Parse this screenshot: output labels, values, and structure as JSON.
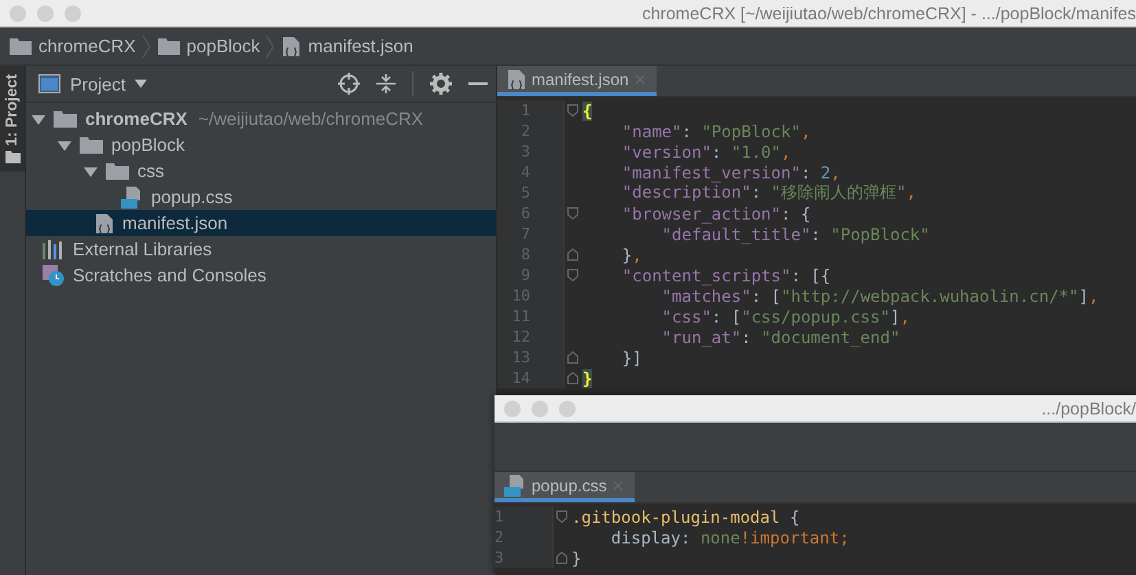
{
  "window": {
    "title": "chromeCRX [~/weijiutao/web/chromeCRX] - .../popBlock/manifes"
  },
  "breadcrumbs": [
    {
      "label": "chromeCRX",
      "kind": "folder"
    },
    {
      "label": "popBlock",
      "kind": "folder"
    },
    {
      "label": "manifest.json",
      "kind": "json"
    }
  ],
  "tool_stripe": {
    "label": "1: Project",
    "selected": true
  },
  "project_panel": {
    "title": "Project",
    "tree": [
      {
        "label": "chromeCRX",
        "hint": "~/weijiutao/web/chromeCRX",
        "kind": "folder",
        "bold": true,
        "expanded": true,
        "selected": false,
        "children": [
          {
            "label": "popBlock",
            "kind": "folder",
            "expanded": true,
            "selected": false,
            "children": [
              {
                "label": "css",
                "kind": "folder",
                "expanded": true,
                "selected": false,
                "children": [
                  {
                    "label": "popup.css",
                    "kind": "css",
                    "selected": false
                  }
                ]
              },
              {
                "label": "manifest.json",
                "kind": "json",
                "selected": true
              }
            ]
          }
        ]
      },
      {
        "label": "External Libraries",
        "kind": "libraries",
        "selected": false
      },
      {
        "label": "Scratches and Consoles",
        "kind": "scratches",
        "selected": false
      }
    ]
  },
  "editor": {
    "tab": {
      "label": "manifest.json",
      "kind": "json",
      "selected": true
    },
    "lines": [
      {
        "number": "1",
        "kind": "opener",
        "tokens": [
          {
            "text": "{",
            "kind": "match"
          }
        ]
      },
      {
        "number": "2",
        "tokens": [
          {
            "text": "    \"name\"",
            "kind": "key"
          },
          {
            "text": ": ",
            "kind": "plain"
          },
          {
            "text": "\"PopBlock\"",
            "kind": "str"
          },
          {
            "text": ",",
            "kind": "punct"
          }
        ]
      },
      {
        "number": "3",
        "tokens": [
          {
            "text": "    \"version\"",
            "kind": "key"
          },
          {
            "text": ": ",
            "kind": "plain"
          },
          {
            "text": "\"1.0\"",
            "kind": "str"
          },
          {
            "text": ",",
            "kind": "punct"
          }
        ]
      },
      {
        "number": "4",
        "tokens": [
          {
            "text": "    \"manifest_version\"",
            "kind": "key"
          },
          {
            "text": ": ",
            "kind": "plain"
          },
          {
            "text": "2",
            "kind": "num"
          },
          {
            "text": ",",
            "kind": "punct"
          }
        ]
      },
      {
        "number": "5",
        "tokens": [
          {
            "text": "    \"description\"",
            "kind": "key"
          },
          {
            "text": ": ",
            "kind": "plain"
          },
          {
            "text": "\"移除闹人的弹框\"",
            "kind": "str"
          },
          {
            "text": ",",
            "kind": "punct"
          }
        ]
      },
      {
        "number": "6",
        "kind": "opener",
        "tokens": [
          {
            "text": "    \"browser_action\"",
            "kind": "key"
          },
          {
            "text": ": {",
            "kind": "plain"
          }
        ]
      },
      {
        "number": "7",
        "tokens": [
          {
            "text": "        \"default_title\"",
            "kind": "key"
          },
          {
            "text": ": ",
            "kind": "plain"
          },
          {
            "text": "\"PopBlock\"",
            "kind": "str"
          }
        ]
      },
      {
        "number": "8",
        "kind": "closer",
        "tokens": [
          {
            "text": "    }",
            "kind": "plain"
          },
          {
            "text": ",",
            "kind": "punct"
          }
        ]
      },
      {
        "number": "9",
        "kind": "opener",
        "tokens": [
          {
            "text": "    \"content_scripts\"",
            "kind": "key"
          },
          {
            "text": ": [{",
            "kind": "plain"
          }
        ]
      },
      {
        "number": "10",
        "tokens": [
          {
            "text": "        \"matches\"",
            "kind": "key"
          },
          {
            "text": ": [",
            "kind": "plain"
          },
          {
            "text": "\"http://webpack.wuhaolin.cn/*\"",
            "kind": "str"
          },
          {
            "text": "]",
            "kind": "plain"
          },
          {
            "text": ",",
            "kind": "punct"
          }
        ]
      },
      {
        "number": "11",
        "tokens": [
          {
            "text": "        \"css\"",
            "kind": "key"
          },
          {
            "text": ": [",
            "kind": "plain"
          },
          {
            "text": "\"css/popup.css\"",
            "kind": "str"
          },
          {
            "text": "]",
            "kind": "plain"
          },
          {
            "text": ",",
            "kind": "punct"
          }
        ]
      },
      {
        "number": "12",
        "tokens": [
          {
            "text": "        \"run_at\"",
            "kind": "key"
          },
          {
            "text": ": ",
            "kind": "plain"
          },
          {
            "text": "\"document_end\"",
            "kind": "str"
          }
        ]
      },
      {
        "number": "13",
        "kind": "closer",
        "tokens": [
          {
            "text": "    }]",
            "kind": "plain"
          }
        ]
      },
      {
        "number": "14",
        "kind": "closer",
        "tokens": [
          {
            "text": "}",
            "kind": "match"
          }
        ]
      }
    ]
  },
  "second_window": {
    "title": ".../popBlock/",
    "tab": {
      "label": "popup.css",
      "kind": "css",
      "selected": true
    },
    "lines": [
      {
        "number": "1",
        "kind": "opener",
        "tokens": [
          {
            "text": ".gitbook-plugin-modal",
            "kind": "selector"
          },
          {
            "text": " {",
            "kind": "plain"
          }
        ]
      },
      {
        "number": "2",
        "tokens": [
          {
            "text": "    display",
            "kind": "plain"
          },
          {
            "text": ": ",
            "kind": "plain"
          },
          {
            "text": "none",
            "kind": "value"
          },
          {
            "text": "!important",
            "kind": "important"
          },
          {
            "text": ";",
            "kind": "punct"
          }
        ]
      },
      {
        "number": "3",
        "kind": "closer",
        "tokens": [
          {
            "text": "}",
            "kind": "plain"
          }
        ]
      }
    ]
  }
}
